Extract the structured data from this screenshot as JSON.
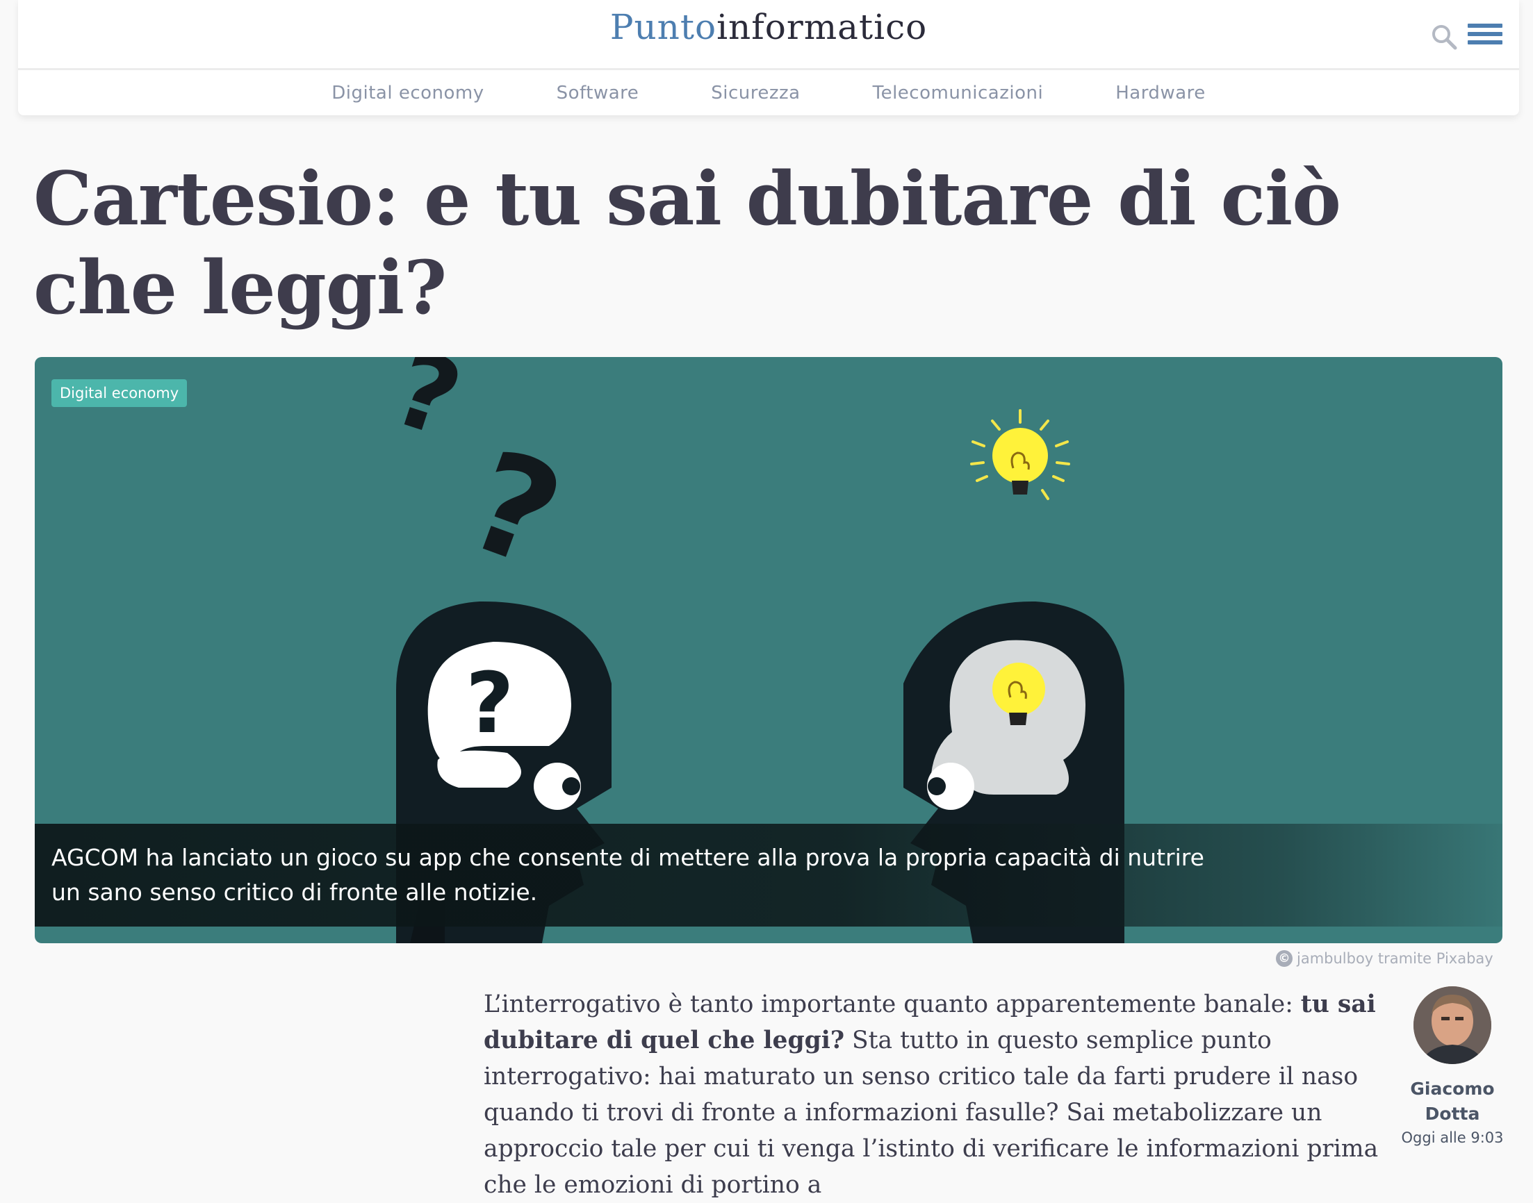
{
  "header": {
    "logo_part1": "Punto",
    "logo_part2": "informatico",
    "nav": [
      "Digital economy",
      "Software",
      "Sicurezza",
      "Telecomunicazioni",
      "Hardware"
    ]
  },
  "article": {
    "title": "Cartesio: e tu sai dubitare di ciò che leggi?",
    "category_badge": "Digital economy",
    "caption": "AGCOM ha lanciato un gioco su app che consente di mettere alla prova la propria capacità di nutrire un sano senso critico di fronte alle notizie.",
    "image_credit": "jambulboy tramite Pixabay",
    "body_intro": "L’interrogativo è tanto importante quanto apparentemente banale: ",
    "body_bold": "tu sai dubitare di quel che leggi?",
    "body_rest": " Sta tutto in questo semplice punto interrogativo: hai maturato un senso critico tale da farti prudere il naso quando ti trovi di fronte a informazioni fasulle? Sai metabolizzare un approccio tale per cui ti venga l’istinto di verificare le informazioni prima che le emozioni di portino a"
  },
  "author": {
    "name": "Giacomo Dotta",
    "date": "Oggi alle 9:03"
  },
  "colors": {
    "brand_blue": "#4d7eb0",
    "hero_teal": "#3b7d7c",
    "badge_teal": "#4cb6ab"
  }
}
